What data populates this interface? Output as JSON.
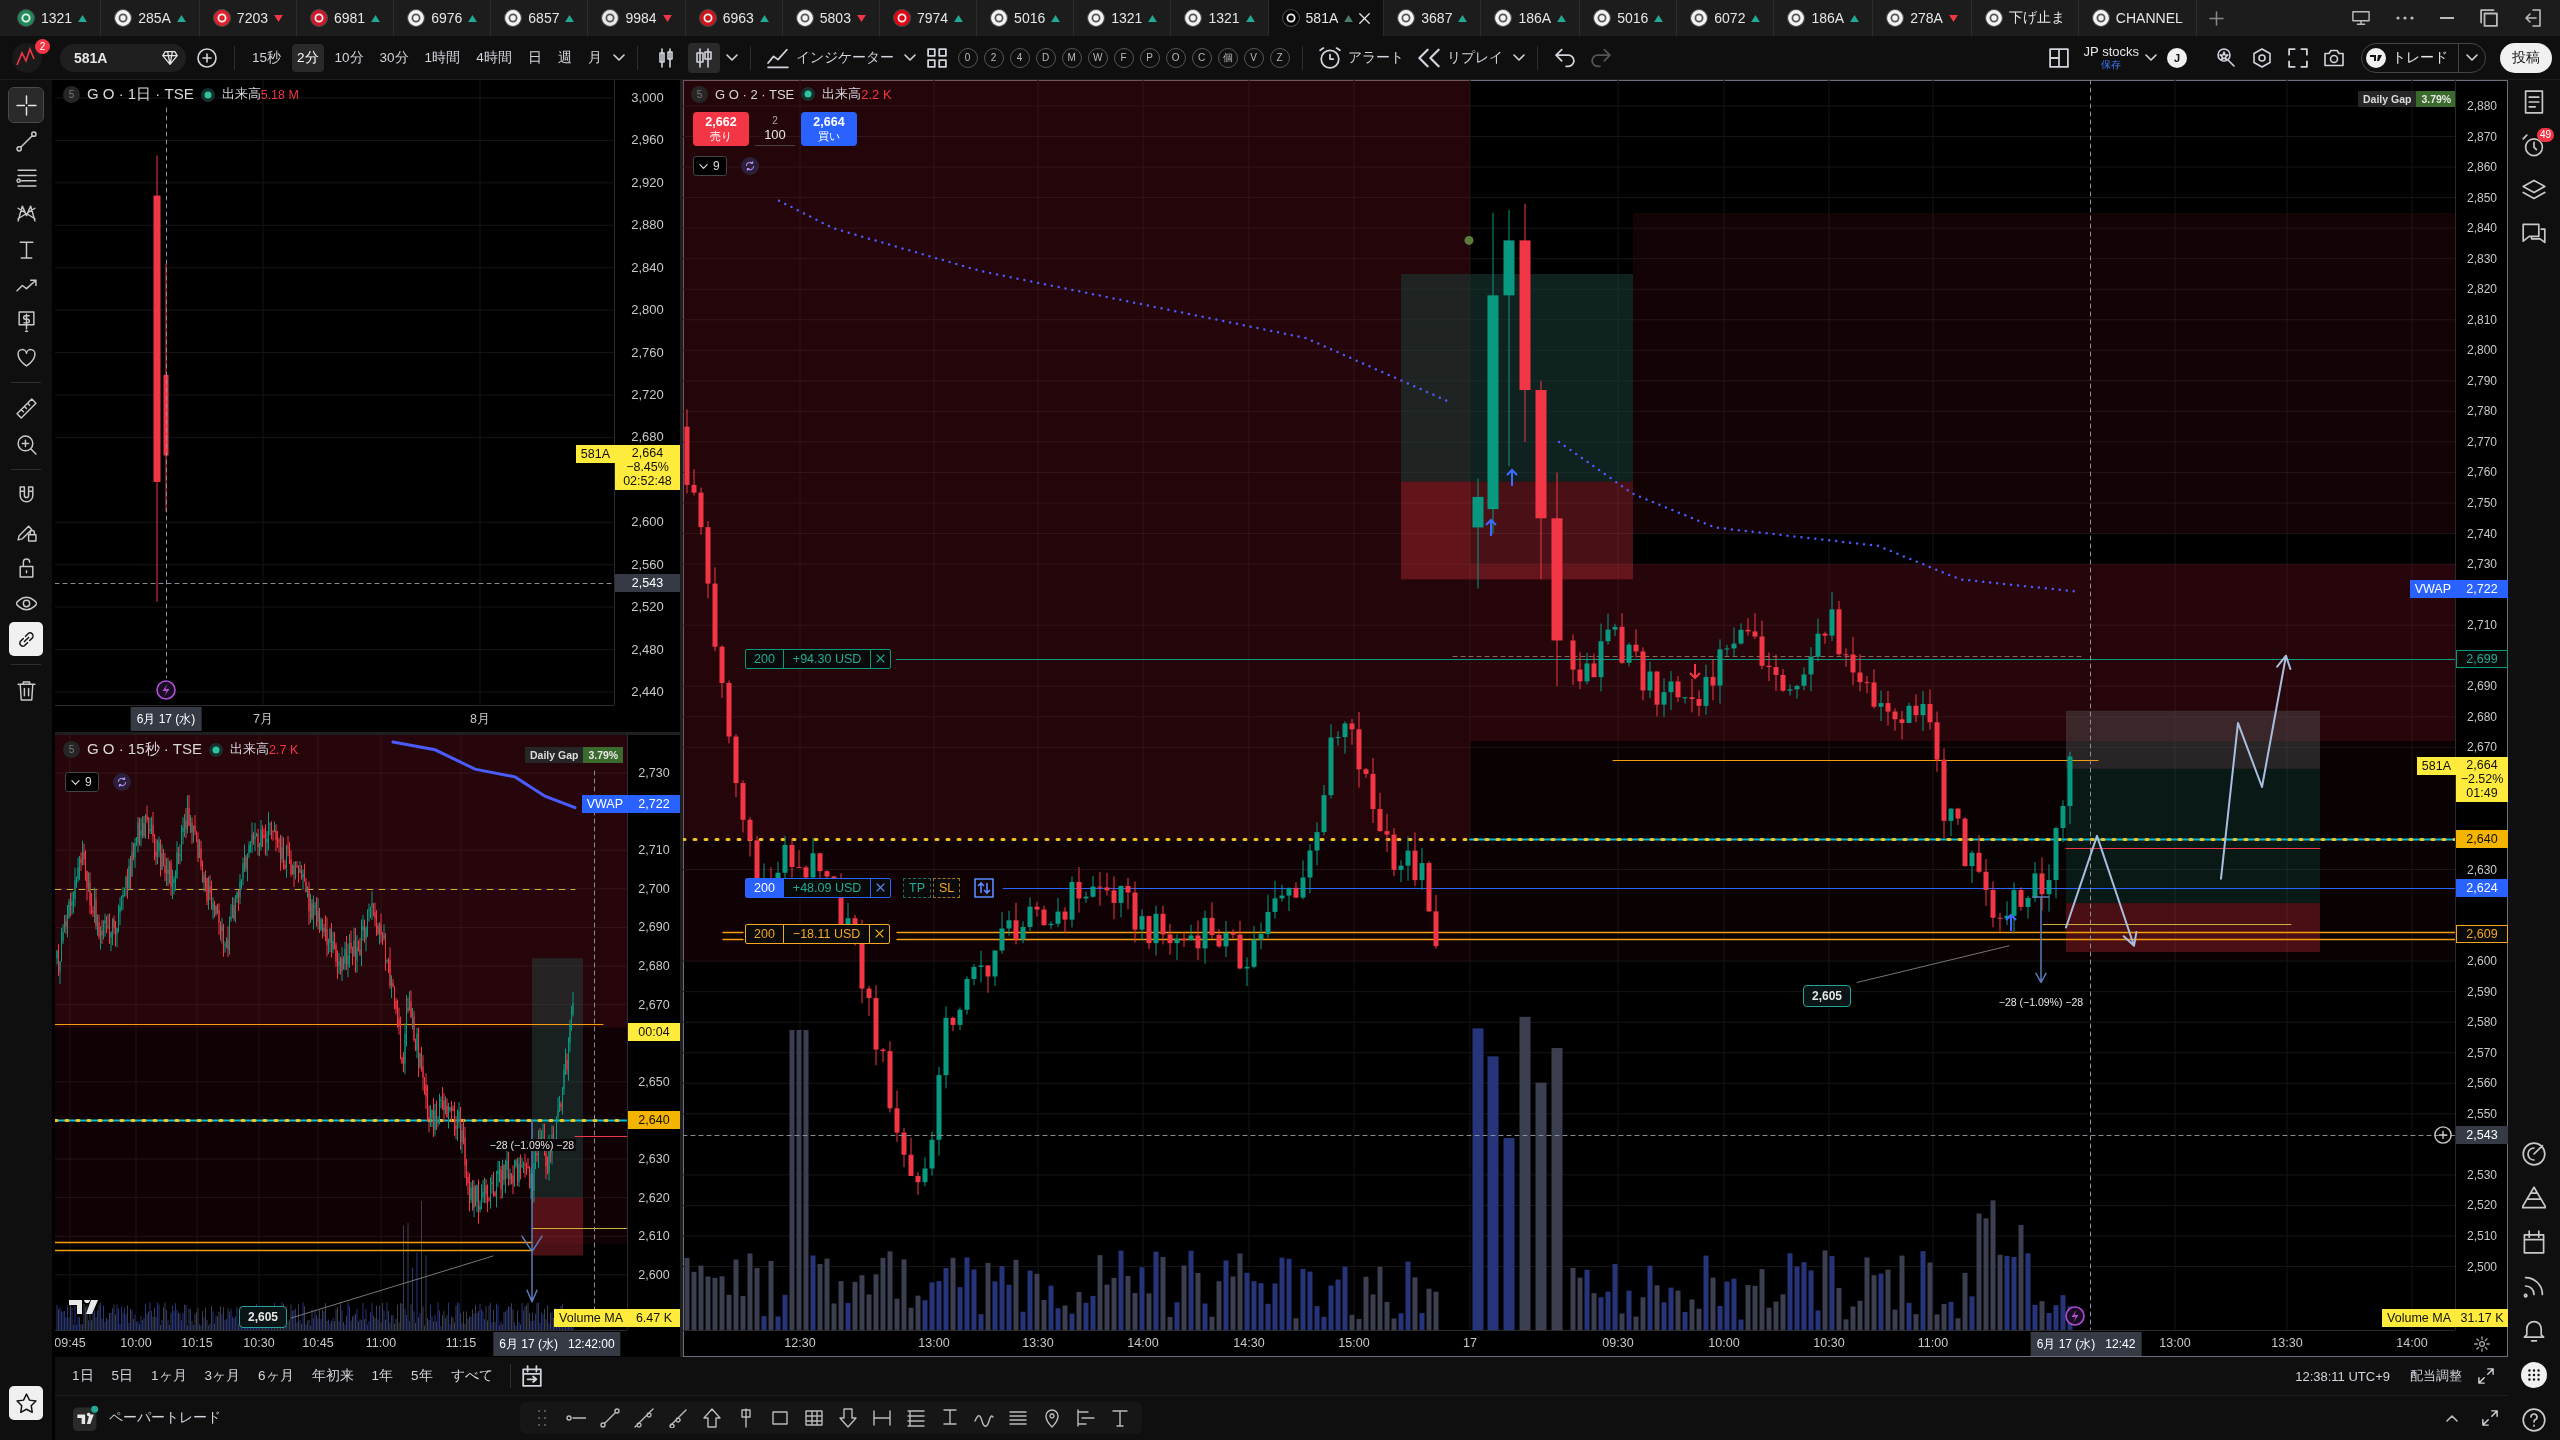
{
  "symbol_tabs": [
    {
      "label": "1321",
      "kind": "up",
      "color": "#1e8c5a",
      "selected": false
    },
    {
      "label": "285A",
      "kind": "up",
      "color": "#f4f4f4",
      "selected": false
    },
    {
      "label": "7203",
      "kind": "down",
      "color": "#e0202a",
      "selected": false
    },
    {
      "label": "6981",
      "kind": "up",
      "color": "#d3162a",
      "selected": false
    },
    {
      "label": "6976",
      "kind": "up",
      "color": "#f4f4f4",
      "selected": false
    },
    {
      "label": "6857",
      "kind": "up",
      "color": "#f4f4f4",
      "selected": false
    },
    {
      "label": "9984",
      "kind": "down",
      "color": "#e8e8e8",
      "selected": false
    },
    {
      "label": "6963",
      "kind": "up",
      "color": "#d0121b",
      "selected": false
    },
    {
      "label": "5803",
      "kind": "down",
      "color": "#f4f4f4",
      "selected": false
    },
    {
      "label": "7974",
      "kind": "up",
      "color": "#e60012",
      "selected": false
    },
    {
      "label": "5016",
      "kind": "up",
      "color": "#f4f4f4",
      "selected": false
    },
    {
      "label": "1321",
      "kind": "up",
      "color": "#f4f4f4",
      "selected": false
    },
    {
      "label": "1321",
      "kind": "up",
      "color": "#f4f4f4",
      "selected": false
    },
    {
      "label": "581A",
      "kind": "up",
      "color": "#000000",
      "selected": true
    },
    {
      "label": "3687",
      "kind": "up",
      "color": "#f4f4f4",
      "selected": false
    },
    {
      "label": "186A",
      "kind": "up",
      "color": "#f4f4f4",
      "selected": false
    },
    {
      "label": "5016",
      "kind": "up",
      "color": "#f4f4f4",
      "selected": false
    },
    {
      "label": "6072",
      "kind": "up",
      "color": "#f4f4f4",
      "selected": false
    },
    {
      "label": "186A",
      "kind": "up",
      "color": "#f4f4f4",
      "selected": false
    },
    {
      "label": "278A",
      "kind": "down",
      "color": "#f4f4f4",
      "selected": false
    },
    {
      "label": "下げ止ま",
      "kind": "plain",
      "color": "#f4f4f4",
      "selected": false
    },
    {
      "label": "CHANNEL",
      "kind": "plain",
      "color": "#f4f4f4",
      "selected": false
    }
  ],
  "toolbar": {
    "notification_count": "2",
    "symbol": "581A",
    "intervals": [
      {
        "label": "15秒",
        "selected": false
      },
      {
        "label": "2分",
        "selected": true
      },
      {
        "label": "10分",
        "selected": false
      },
      {
        "label": "30分",
        "selected": false
      },
      {
        "label": "1時間",
        "selected": false
      },
      {
        "label": "4時間",
        "selected": false
      },
      {
        "label": "日",
        "selected": false
      },
      {
        "label": "週",
        "selected": false
      },
      {
        "label": "月",
        "selected": false
      }
    ],
    "chart_styles": [
      {
        "kind": "candles",
        "selected": false
      },
      {
        "kind": "columns",
        "selected": true
      }
    ],
    "indicators_label": "インジケーター",
    "quick_buttons": [
      "0",
      "2",
      "4",
      "D",
      "M",
      "W",
      "F",
      "P",
      "O",
      "C",
      "個",
      "V",
      "Z"
    ],
    "alert_label": "アラート",
    "replay_label": "リプレイ",
    "layout_name": "JP stocks",
    "save_status": "保存",
    "user_initial": "J",
    "trade_label": "トレード",
    "publish_label": "投稿"
  },
  "drawing_tools": [
    {
      "kind": "crosshair",
      "selected": true,
      "on": false
    },
    {
      "kind": "trend_line",
      "selected": false,
      "on": false
    },
    {
      "kind": "horizontal_lines",
      "selected": false,
      "on": false
    },
    {
      "kind": "pattern",
      "selected": false,
      "on": false
    },
    {
      "kind": "projection",
      "selected": false,
      "on": false
    },
    {
      "kind": "path",
      "selected": false,
      "on": false
    },
    {
      "kind": "money",
      "selected": false,
      "on": false
    },
    {
      "kind": "heart",
      "selected": false,
      "on": false
    },
    {
      "kind": "ruler",
      "selected": false,
      "on": false
    },
    {
      "kind": "zoom",
      "selected": false,
      "on": false
    },
    {
      "kind": "magnet",
      "selected": false,
      "on": false
    },
    {
      "kind": "pencil_lock",
      "selected": false,
      "on": false
    },
    {
      "kind": "lock",
      "selected": false,
      "on": false
    },
    {
      "kind": "eye",
      "selected": false,
      "on": false
    },
    {
      "kind": "link",
      "selected": false,
      "on": true
    },
    {
      "kind": "trash",
      "selected": false,
      "on": false
    }
  ],
  "charts": [
    {
      "kind": "daily",
      "legend": {
        "badge": "5",
        "title": "G O · 1日 · TSE",
        "volume_label": "出来高",
        "volume_value": "5.18 M"
      },
      "price_ticks": [
        "3,000",
        "2,960",
        "2,920",
        "2,880",
        "2,840",
        "2,800",
        "2,760",
        "2,720",
        "2,680",
        "2,600",
        "2,560",
        "2,520",
        "2,480",
        "2,440"
      ],
      "time_ticks": [
        "7月",
        "8月"
      ],
      "cursor_time": {
        "date": "6月 17 (水)"
      },
      "axis_labels": [
        {
          "kind": "last",
          "tag": "581A",
          "value": "2,664",
          "sub": [
            "−8.45%",
            "02:52:48"
          ]
        },
        {
          "kind": "crosshair",
          "value": "2,543"
        }
      ]
    },
    {
      "kind": "seconds",
      "legend": {
        "badge": "5",
        "title": "G O · 15秒 · TSE",
        "volume_label": "出来高",
        "volume_value": "2.7 K"
      },
      "indicator_toggle": {
        "count": "9"
      },
      "daily_gap": {
        "label": "Daily Gap",
        "value": "3.79%"
      },
      "price_ticks": [
        "2,730",
        "2,710",
        "2,700",
        "2,690",
        "2,680",
        "2,670",
        "2,650",
        "2,630",
        "2,620",
        "2,610",
        "2,600"
      ],
      "time_ticks": [
        "09:45",
        "10:00",
        "10:15",
        "10:30",
        "10:45",
        "11:00",
        "11:15"
      ],
      "cursor_time": {
        "date": "6月 17 (水)",
        "time": "12:42:00"
      },
      "axis_labels": [
        {
          "kind": "vwap",
          "tag": "VWAP",
          "value": "2,722"
        },
        {
          "kind": "countdown",
          "value": "00:04"
        },
        {
          "kind": "alert",
          "value": "2,640"
        },
        {
          "kind": "volume_ma",
          "tag": "Volume MA",
          "value": "6.47 K"
        }
      ],
      "price_note": "2,605",
      "measure_label": "−28 (−1.09%) −28"
    },
    {
      "kind": "main",
      "legend": {
        "badge": "5",
        "title": "G O · 2 · TSE",
        "volume_label": "出来高",
        "volume_value": "2.2 K"
      },
      "order_ticket": {
        "sell_price": "2,662",
        "sell_label": "売り",
        "step": "2",
        "quantity": "100",
        "buy_price": "2,664",
        "buy_label": "買い"
      },
      "indicator_toggle": {
        "count": "9"
      },
      "daily_gap": {
        "label": "Daily Gap",
        "value": "3.79%"
      },
      "price_ticks": [
        "2,880",
        "2,870",
        "2,860",
        "2,850",
        "2,840",
        "2,830",
        "2,820",
        "2,810",
        "2,800",
        "2,790",
        "2,780",
        "2,770",
        "2,760",
        "2,750",
        "2,740",
        "2,730",
        "2,710",
        "2,690",
        "2,680",
        "2,670",
        "2,630",
        "2,600",
        "2,590",
        "2,580",
        "2,570",
        "2,560",
        "2,550",
        "2,530",
        "2,520",
        "2,510",
        "2,500"
      ],
      "time_ticks": [
        "12:30",
        "13:00",
        "13:30",
        "14:00",
        "14:30",
        "15:00",
        "17",
        "09:30",
        "10:00",
        "10:30",
        "11:00",
        "13:00",
        "13:30",
        "14:00"
      ],
      "cursor_time": {
        "date": "6月 17 (水)",
        "time": "12:42"
      },
      "axis_labels": [
        {
          "kind": "vwap",
          "tag": "VWAP",
          "value": "2,722"
        },
        {
          "kind": "target",
          "value": "2,699"
        },
        {
          "kind": "last",
          "tag": "581A",
          "value": "2,664",
          "sub": [
            "−2.52%",
            "01:49"
          ]
        },
        {
          "kind": "alert",
          "value": "2,640"
        },
        {
          "kind": "order",
          "value": "2,624"
        },
        {
          "kind": "stop",
          "value": "2,609"
        },
        {
          "kind": "crosshair",
          "value": "2,543"
        },
        {
          "kind": "volume_ma",
          "tag": "Volume MA",
          "value": "31.17 K"
        }
      ],
      "positions": [
        {
          "kind": "target",
          "quantity": "200",
          "pnl": "+94.30 USD"
        },
        {
          "kind": "order",
          "quantity": "200",
          "pnl": "+48.09 USD",
          "brackets": [
            "TP",
            "SL"
          ]
        },
        {
          "kind": "stop",
          "quantity": "200",
          "pnl": "−18.11 USD"
        }
      ],
      "price_note": "2,605",
      "measure_label": "−28 (−1.09%) −28"
    }
  ],
  "right_sidebar": [
    {
      "kind": "watchlist"
    },
    {
      "kind": "alerts",
      "badge": "49"
    },
    {
      "kind": "layers"
    },
    {
      "kind": "chat"
    },
    {
      "kind": "target"
    },
    {
      "kind": "pyramid"
    },
    {
      "kind": "calendar"
    },
    {
      "kind": "signal"
    },
    {
      "kind": "notifications"
    },
    {
      "kind": "apps"
    },
    {
      "kind": "help"
    }
  ],
  "range_bar": {
    "ranges": [
      "1日",
      "5日",
      "1ヶ月",
      "3ヶ月",
      "6ヶ月",
      "年初来",
      "1年",
      "5年",
      "すべて"
    ],
    "clock": "12:38:11 UTC+9",
    "adjustment": "配当調整"
  },
  "footer": {
    "paper_trading": "ペーパートレード"
  }
}
